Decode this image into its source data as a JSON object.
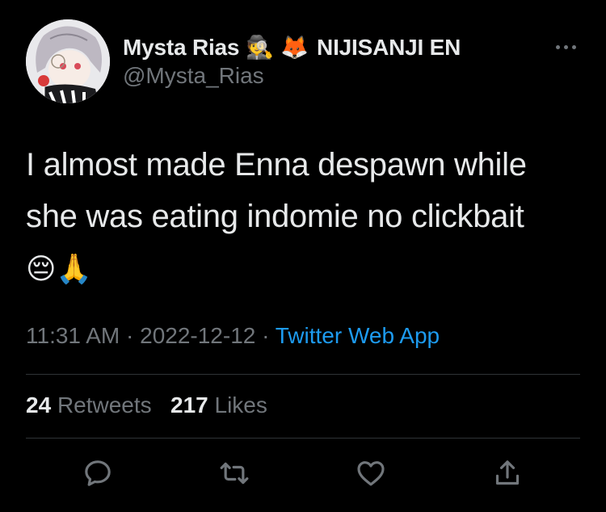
{
  "author": {
    "display_name": "Mysta Rias",
    "name_emojis": [
      "🕵️",
      "🦊"
    ],
    "affiliation": "NIJISANJI EN",
    "handle": "@Mysta_Rias"
  },
  "tweet": {
    "text": "I almost made Enna despawn while she was eating indomie no clickbait",
    "emojis": "😔🙏"
  },
  "meta": {
    "time": "11:31 AM",
    "separator": "·",
    "date": "2022-12-12",
    "source": "Twitter Web App"
  },
  "stats": {
    "retweets_count": "24",
    "retweets_label": "Retweets",
    "likes_count": "217",
    "likes_label": "Likes"
  },
  "actions": [
    {
      "name": "reply",
      "icon": "reply-icon"
    },
    {
      "name": "retweet",
      "icon": "retweet-icon"
    },
    {
      "name": "like",
      "icon": "heart-icon"
    },
    {
      "name": "share",
      "icon": "share-icon"
    }
  ],
  "colors": {
    "background": "#000000",
    "text_primary": "#e7e9ea",
    "text_secondary": "#71767b",
    "link": "#1d9bf0",
    "divider": "#2f3336"
  }
}
